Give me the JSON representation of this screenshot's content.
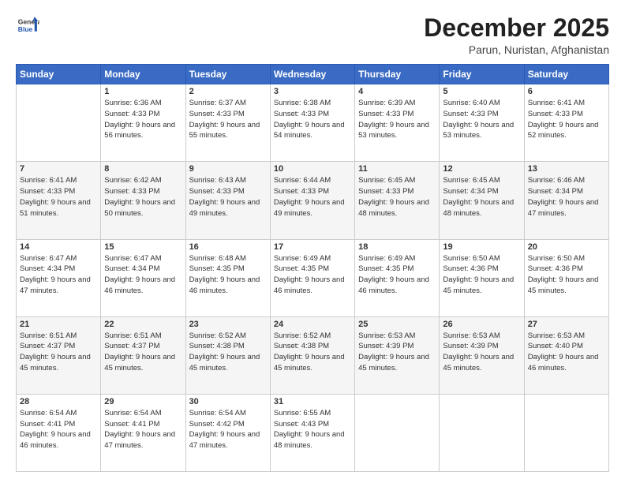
{
  "header": {
    "logo_general": "General",
    "logo_blue": "Blue",
    "month": "December 2025",
    "location": "Parun, Nuristan, Afghanistan"
  },
  "days_of_week": [
    "Sunday",
    "Monday",
    "Tuesday",
    "Wednesday",
    "Thursday",
    "Friday",
    "Saturday"
  ],
  "weeks": [
    [
      {
        "num": "",
        "sunrise": "",
        "sunset": "",
        "daylight": ""
      },
      {
        "num": "1",
        "sunrise": "Sunrise: 6:36 AM",
        "sunset": "Sunset: 4:33 PM",
        "daylight": "Daylight: 9 hours and 56 minutes."
      },
      {
        "num": "2",
        "sunrise": "Sunrise: 6:37 AM",
        "sunset": "Sunset: 4:33 PM",
        "daylight": "Daylight: 9 hours and 55 minutes."
      },
      {
        "num": "3",
        "sunrise": "Sunrise: 6:38 AM",
        "sunset": "Sunset: 4:33 PM",
        "daylight": "Daylight: 9 hours and 54 minutes."
      },
      {
        "num": "4",
        "sunrise": "Sunrise: 6:39 AM",
        "sunset": "Sunset: 4:33 PM",
        "daylight": "Daylight: 9 hours and 53 minutes."
      },
      {
        "num": "5",
        "sunrise": "Sunrise: 6:40 AM",
        "sunset": "Sunset: 4:33 PM",
        "daylight": "Daylight: 9 hours and 53 minutes."
      },
      {
        "num": "6",
        "sunrise": "Sunrise: 6:41 AM",
        "sunset": "Sunset: 4:33 PM",
        "daylight": "Daylight: 9 hours and 52 minutes."
      }
    ],
    [
      {
        "num": "7",
        "sunrise": "Sunrise: 6:41 AM",
        "sunset": "Sunset: 4:33 PM",
        "daylight": "Daylight: 9 hours and 51 minutes."
      },
      {
        "num": "8",
        "sunrise": "Sunrise: 6:42 AM",
        "sunset": "Sunset: 4:33 PM",
        "daylight": "Daylight: 9 hours and 50 minutes."
      },
      {
        "num": "9",
        "sunrise": "Sunrise: 6:43 AM",
        "sunset": "Sunset: 4:33 PM",
        "daylight": "Daylight: 9 hours and 49 minutes."
      },
      {
        "num": "10",
        "sunrise": "Sunrise: 6:44 AM",
        "sunset": "Sunset: 4:33 PM",
        "daylight": "Daylight: 9 hours and 49 minutes."
      },
      {
        "num": "11",
        "sunrise": "Sunrise: 6:45 AM",
        "sunset": "Sunset: 4:33 PM",
        "daylight": "Daylight: 9 hours and 48 minutes."
      },
      {
        "num": "12",
        "sunrise": "Sunrise: 6:45 AM",
        "sunset": "Sunset: 4:34 PM",
        "daylight": "Daylight: 9 hours and 48 minutes."
      },
      {
        "num": "13",
        "sunrise": "Sunrise: 6:46 AM",
        "sunset": "Sunset: 4:34 PM",
        "daylight": "Daylight: 9 hours and 47 minutes."
      }
    ],
    [
      {
        "num": "14",
        "sunrise": "Sunrise: 6:47 AM",
        "sunset": "Sunset: 4:34 PM",
        "daylight": "Daylight: 9 hours and 47 minutes."
      },
      {
        "num": "15",
        "sunrise": "Sunrise: 6:47 AM",
        "sunset": "Sunset: 4:34 PM",
        "daylight": "Daylight: 9 hours and 46 minutes."
      },
      {
        "num": "16",
        "sunrise": "Sunrise: 6:48 AM",
        "sunset": "Sunset: 4:35 PM",
        "daylight": "Daylight: 9 hours and 46 minutes."
      },
      {
        "num": "17",
        "sunrise": "Sunrise: 6:49 AM",
        "sunset": "Sunset: 4:35 PM",
        "daylight": "Daylight: 9 hours and 46 minutes."
      },
      {
        "num": "18",
        "sunrise": "Sunrise: 6:49 AM",
        "sunset": "Sunset: 4:35 PM",
        "daylight": "Daylight: 9 hours and 46 minutes."
      },
      {
        "num": "19",
        "sunrise": "Sunrise: 6:50 AM",
        "sunset": "Sunset: 4:36 PM",
        "daylight": "Daylight: 9 hours and 45 minutes."
      },
      {
        "num": "20",
        "sunrise": "Sunrise: 6:50 AM",
        "sunset": "Sunset: 4:36 PM",
        "daylight": "Daylight: 9 hours and 45 minutes."
      }
    ],
    [
      {
        "num": "21",
        "sunrise": "Sunrise: 6:51 AM",
        "sunset": "Sunset: 4:37 PM",
        "daylight": "Daylight: 9 hours and 45 minutes."
      },
      {
        "num": "22",
        "sunrise": "Sunrise: 6:51 AM",
        "sunset": "Sunset: 4:37 PM",
        "daylight": "Daylight: 9 hours and 45 minutes."
      },
      {
        "num": "23",
        "sunrise": "Sunrise: 6:52 AM",
        "sunset": "Sunset: 4:38 PM",
        "daylight": "Daylight: 9 hours and 45 minutes."
      },
      {
        "num": "24",
        "sunrise": "Sunrise: 6:52 AM",
        "sunset": "Sunset: 4:38 PM",
        "daylight": "Daylight: 9 hours and 45 minutes."
      },
      {
        "num": "25",
        "sunrise": "Sunrise: 6:53 AM",
        "sunset": "Sunset: 4:39 PM",
        "daylight": "Daylight: 9 hours and 45 minutes."
      },
      {
        "num": "26",
        "sunrise": "Sunrise: 6:53 AM",
        "sunset": "Sunset: 4:39 PM",
        "daylight": "Daylight: 9 hours and 45 minutes."
      },
      {
        "num": "27",
        "sunrise": "Sunrise: 6:53 AM",
        "sunset": "Sunset: 4:40 PM",
        "daylight": "Daylight: 9 hours and 46 minutes."
      }
    ],
    [
      {
        "num": "28",
        "sunrise": "Sunrise: 6:54 AM",
        "sunset": "Sunset: 4:41 PM",
        "daylight": "Daylight: 9 hours and 46 minutes."
      },
      {
        "num": "29",
        "sunrise": "Sunrise: 6:54 AM",
        "sunset": "Sunset: 4:41 PM",
        "daylight": "Daylight: 9 hours and 47 minutes."
      },
      {
        "num": "30",
        "sunrise": "Sunrise: 6:54 AM",
        "sunset": "Sunset: 4:42 PM",
        "daylight": "Daylight: 9 hours and 47 minutes."
      },
      {
        "num": "31",
        "sunrise": "Sunrise: 6:55 AM",
        "sunset": "Sunset: 4:43 PM",
        "daylight": "Daylight: 9 hours and 48 minutes."
      },
      {
        "num": "",
        "sunrise": "",
        "sunset": "",
        "daylight": ""
      },
      {
        "num": "",
        "sunrise": "",
        "sunset": "",
        "daylight": ""
      },
      {
        "num": "",
        "sunrise": "",
        "sunset": "",
        "daylight": ""
      }
    ]
  ]
}
